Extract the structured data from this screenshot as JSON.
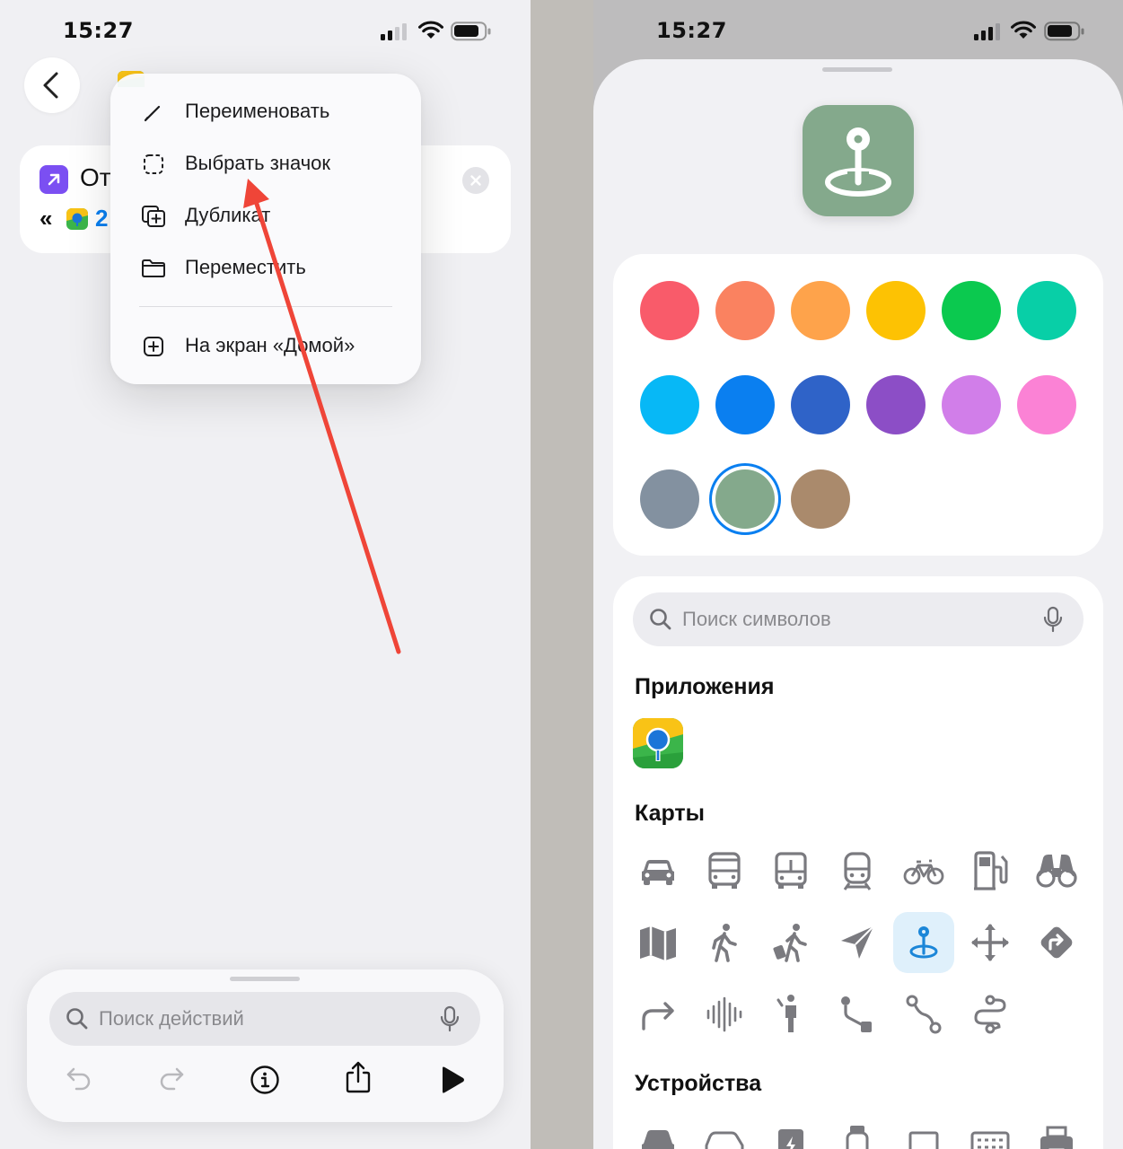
{
  "left": {
    "status_time": "15:27",
    "action_card": {
      "title": "От",
      "param_prefix": "«",
      "param_value": "2"
    },
    "context_menu": {
      "items": [
        {
          "label": "Переименовать",
          "icon": "pencil-icon"
        },
        {
          "label": "Выбрать значок",
          "icon": "dashed-square-icon"
        },
        {
          "label": "Дубликат",
          "icon": "duplicate-icon"
        },
        {
          "label": "Переместить",
          "icon": "folder-icon"
        },
        {
          "label": "На экран «Домой»",
          "icon": "plus-square-icon"
        }
      ]
    },
    "actions_sheet": {
      "search_placeholder": "Поиск действий"
    }
  },
  "right": {
    "status_time": "15:27",
    "selected_icon": "location-pin-icon",
    "selected_color": "#84a98c",
    "colors": [
      "#f95b6a",
      "#fa8260",
      "#fea34b",
      "#fdc203",
      "#0bc94f",
      "#08cfa7",
      "#07b8f6",
      "#0a7ff0",
      "#2f63c8",
      "#8c4ec6",
      "#d17ee9",
      "#fb82d5",
      "#8391a0",
      "#84a98c",
      "#aa8a6c"
    ],
    "search_placeholder": "Поиск символов",
    "sections": {
      "apps": "Приложения",
      "maps": "Карты",
      "devices": "Устройства"
    },
    "map_symbols": [
      "car-icon",
      "bus-icon",
      "bus-front-icon",
      "tram-icon",
      "bicycle-icon",
      "fuel-pump-icon",
      "binoculars-icon",
      "map-icon",
      "walking-icon",
      "walking-luggage-icon",
      "location-arrow-icon",
      "location-pin-icon",
      "move-arrows-icon",
      "directions-sign-icon",
      "arrow-turn-right-icon",
      "waveform-icon",
      "figure-stand-icon",
      "path-icon",
      "route-icon",
      "s-curve-path-icon"
    ]
  }
}
